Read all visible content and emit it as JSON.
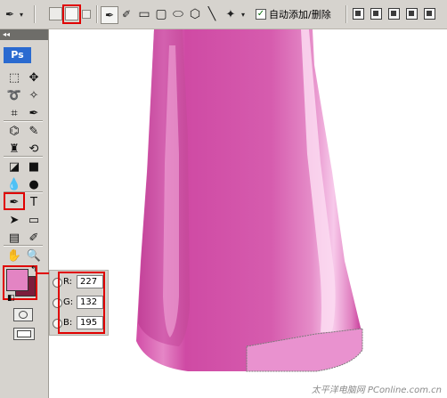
{
  "options_bar": {
    "auto_add_delete_label": "自动添加/删除",
    "auto_add_delete_checked": true
  },
  "toolbox": {
    "logo": "Ps",
    "tools": [
      {
        "name": "marquee-tool",
        "glyph": "⬚"
      },
      {
        "name": "move-tool",
        "glyph": "✥"
      },
      {
        "name": "lasso-tool",
        "glyph": "➰"
      },
      {
        "name": "magic-wand-tool",
        "glyph": "✧"
      },
      {
        "name": "crop-tool",
        "glyph": "⌗"
      },
      {
        "name": "slice-tool",
        "glyph": "✒"
      },
      {
        "name": "healing-brush-tool",
        "glyph": "⌬"
      },
      {
        "name": "brush-tool",
        "glyph": "✎"
      },
      {
        "name": "clone-stamp-tool",
        "glyph": "♜"
      },
      {
        "name": "history-brush-tool",
        "glyph": "⟲"
      },
      {
        "name": "eraser-tool",
        "glyph": "◪"
      },
      {
        "name": "gradient-tool",
        "glyph": "■"
      },
      {
        "name": "blur-tool",
        "glyph": "💧"
      },
      {
        "name": "dodge-tool",
        "glyph": "●"
      },
      {
        "name": "pen-tool",
        "glyph": "✒"
      },
      {
        "name": "type-tool",
        "glyph": "T"
      },
      {
        "name": "path-selection-tool",
        "glyph": "➤"
      },
      {
        "name": "shape-tool",
        "glyph": "▭"
      },
      {
        "name": "notes-tool",
        "glyph": "▤"
      },
      {
        "name": "eyedropper-tool",
        "glyph": "✐"
      },
      {
        "name": "hand-tool",
        "glyph": "✋"
      },
      {
        "name": "zoom-tool",
        "glyph": "🔍"
      }
    ]
  },
  "colors": {
    "foreground": "#e384c3",
    "background": "#7c1d3c",
    "highlight": "#e00000"
  },
  "color_picker": {
    "r_label": "R:",
    "r_value": "227",
    "g_label": "G:",
    "g_value": "132",
    "b_label": "B:",
    "b_value": "195"
  },
  "watermark": "太平洋电脑网 PConline.com.cn"
}
